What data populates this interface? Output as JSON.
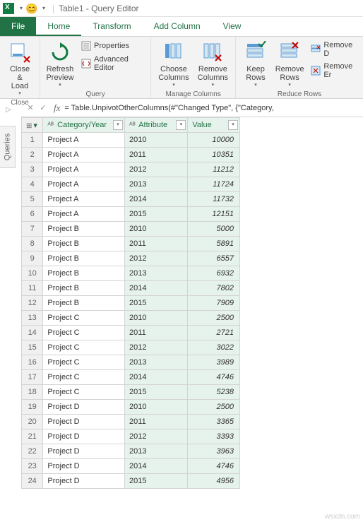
{
  "title_bar": {
    "window_title": "Table1 - Query Editor"
  },
  "tabs": {
    "file": "File",
    "home": "Home",
    "transform": "Transform",
    "add_column": "Add Column",
    "view": "View"
  },
  "ribbon": {
    "close_group": {
      "close_load": "Close &\nLoad",
      "group_label": "Close"
    },
    "query_group": {
      "refresh_preview": "Refresh\nPreview",
      "properties": "Properties",
      "advanced_editor": "Advanced Editor",
      "group_label": "Query"
    },
    "manage_columns_group": {
      "choose_columns": "Choose\nColumns",
      "remove_columns": "Remove\nColumns",
      "group_label": "Manage Columns"
    },
    "reduce_rows_group": {
      "keep_rows": "Keep\nRows",
      "remove_rows": "Remove\nRows",
      "remove_duplicates": "Remove D",
      "remove_errors": "Remove Er",
      "group_label": "Reduce Rows"
    }
  },
  "formula_bar": {
    "formula": "= Table.UnpivotOtherColumns(#\"Changed Type\", {\"Category,"
  },
  "side_panel": {
    "label": "Queries"
  },
  "table": {
    "headers": {
      "category": "Category/Year",
      "attribute": "Attribute",
      "value": "Value"
    },
    "rows": [
      {
        "n": "1",
        "cat": "Project A",
        "attr": "2010",
        "val": "10000"
      },
      {
        "n": "2",
        "cat": "Project A",
        "attr": "2011",
        "val": "10351"
      },
      {
        "n": "3",
        "cat": "Project A",
        "attr": "2012",
        "val": "11212"
      },
      {
        "n": "4",
        "cat": "Project A",
        "attr": "2013",
        "val": "11724"
      },
      {
        "n": "5",
        "cat": "Project A",
        "attr": "2014",
        "val": "11732"
      },
      {
        "n": "6",
        "cat": "Project A",
        "attr": "2015",
        "val": "12151"
      },
      {
        "n": "7",
        "cat": "Project B",
        "attr": "2010",
        "val": "5000"
      },
      {
        "n": "8",
        "cat": "Project B",
        "attr": "2011",
        "val": "5891"
      },
      {
        "n": "9",
        "cat": "Project B",
        "attr": "2012",
        "val": "6557"
      },
      {
        "n": "10",
        "cat": "Project B",
        "attr": "2013",
        "val": "6932"
      },
      {
        "n": "11",
        "cat": "Project B",
        "attr": "2014",
        "val": "7802"
      },
      {
        "n": "12",
        "cat": "Project B",
        "attr": "2015",
        "val": "7909"
      },
      {
        "n": "13",
        "cat": "Project C",
        "attr": "2010",
        "val": "2500"
      },
      {
        "n": "14",
        "cat": "Project C",
        "attr": "2011",
        "val": "2721"
      },
      {
        "n": "15",
        "cat": "Project C",
        "attr": "2012",
        "val": "3022"
      },
      {
        "n": "16",
        "cat": "Project C",
        "attr": "2013",
        "val": "3989"
      },
      {
        "n": "17",
        "cat": "Project C",
        "attr": "2014",
        "val": "4746"
      },
      {
        "n": "18",
        "cat": "Project C",
        "attr": "2015",
        "val": "5238"
      },
      {
        "n": "19",
        "cat": "Project D",
        "attr": "2010",
        "val": "2500"
      },
      {
        "n": "20",
        "cat": "Project D",
        "attr": "2011",
        "val": "3365"
      },
      {
        "n": "21",
        "cat": "Project D",
        "attr": "2012",
        "val": "3393"
      },
      {
        "n": "22",
        "cat": "Project D",
        "attr": "2013",
        "val": "3963"
      },
      {
        "n": "23",
        "cat": "Project D",
        "attr": "2014",
        "val": "4746"
      },
      {
        "n": "24",
        "cat": "Project D",
        "attr": "2015",
        "val": "4956"
      }
    ]
  },
  "watermark": "wsxdn.com"
}
